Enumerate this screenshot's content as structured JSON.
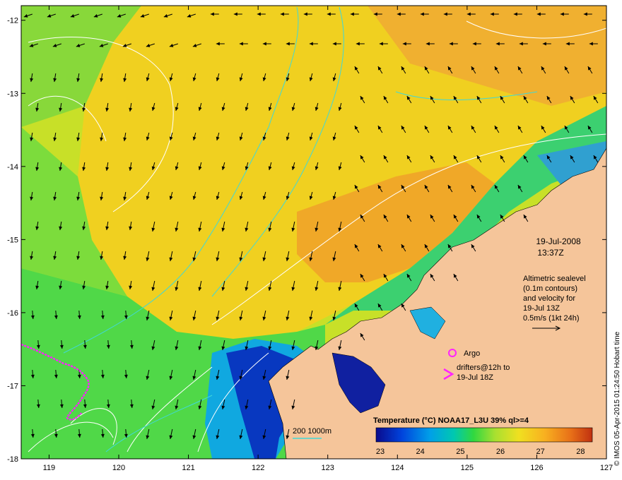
{
  "map": {
    "x_axis": {
      "unit": "longitude_deg_E",
      "min": 118.6,
      "max": 127,
      "ticks": [
        "119",
        "120",
        "121",
        "122",
        "123",
        "124",
        "125",
        "126",
        "127"
      ]
    },
    "y_axis": {
      "unit": "latitude_deg_S",
      "min": -18,
      "max": -11.8,
      "ticks": [
        "-12",
        "-13",
        "-14",
        "-15",
        "-16",
        "-17",
        "-18"
      ]
    },
    "date": "19-Jul-2008",
    "time": "13:37Z",
    "legend_lines": [
      "Altimetric sealevel",
      "(0.1m contours)",
      "and velocity for",
      "19-Jul 13Z",
      "0.5m/s (1kt 24h)"
    ],
    "argo_label": "Argo",
    "drifter_lines": [
      "drifters@12h to",
      "19-Jul 18Z"
    ],
    "isobath_label": "200  1000m",
    "colorbar": {
      "title": "Temperature (°C) NOAA17_L3U 39% ql>=4",
      "min": 23,
      "max": 28.4,
      "ticks": [
        "23",
        "24",
        "25",
        "26",
        "27",
        "28"
      ],
      "colors": [
        "#0a0a8c",
        "#0044dd",
        "#00a0e8",
        "#00c8b0",
        "#30d840",
        "#a8e030",
        "#f0e020",
        "#f8b020",
        "#e87018",
        "#c03010"
      ]
    },
    "credit": "© IMOS 05-Apr-2015 01:24:50 Hobart time",
    "colors": {
      "land": "#f5c59a",
      "arrow": "#000000",
      "isobath": "#40d8d8",
      "contour": "#ffffff",
      "drifter": "#ff22ff",
      "frame": "#000000"
    }
  }
}
